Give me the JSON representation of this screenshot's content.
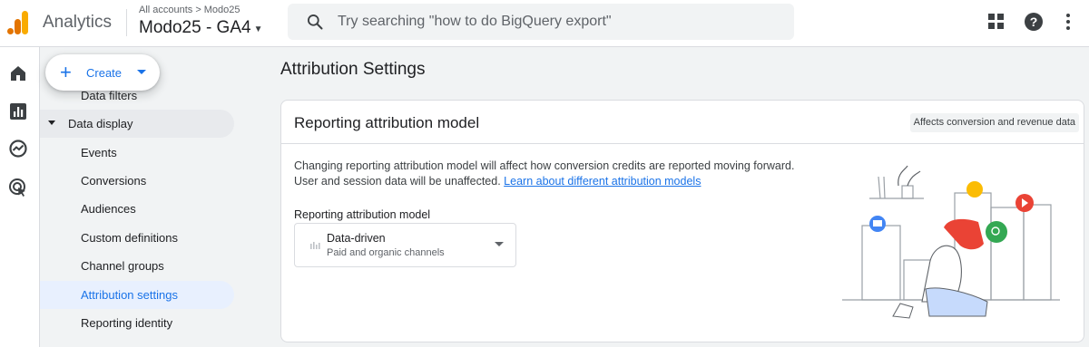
{
  "header": {
    "app_name": "Analytics",
    "breadcrumb_root": "All accounts",
    "breadcrumb_account": "Modo25",
    "property_name": "Modo25 - GA4",
    "search_placeholder": "Try searching \"how to do BigQuery export\""
  },
  "icons": {
    "header": [
      "apps-grid-icon",
      "help-icon",
      "more-vert-icon"
    ],
    "rail": [
      "home-icon",
      "reports-icon",
      "explore-icon",
      "advertising-icon"
    ]
  },
  "create": {
    "label": "Create"
  },
  "nav": {
    "partial_item": "Data filters",
    "parent": "Data display",
    "items": [
      "Events",
      "Conversions",
      "Audiences",
      "Custom definitions",
      "Channel groups",
      "Attribution settings",
      "Reporting identity"
    ],
    "active": "Attribution settings"
  },
  "page": {
    "title": "Attribution Settings"
  },
  "card": {
    "title": "Reporting attribution model",
    "chip": "Affects conversion and revenue data",
    "desc_line1": "Changing reporting attribution model will affect how conversion credits are reported moving forward.",
    "desc_line2": "User and session data will be unaffected.",
    "learn_link": "Learn about different attribution models",
    "field_label": "Reporting attribution model",
    "select_value": "Data-driven",
    "select_sub": "Paid and organic channels"
  },
  "colors": {
    "accent": "#1a73e8",
    "active_bg": "#e8f0fe",
    "logo_orange": "#f9ab00",
    "logo_dark": "#e37400"
  }
}
